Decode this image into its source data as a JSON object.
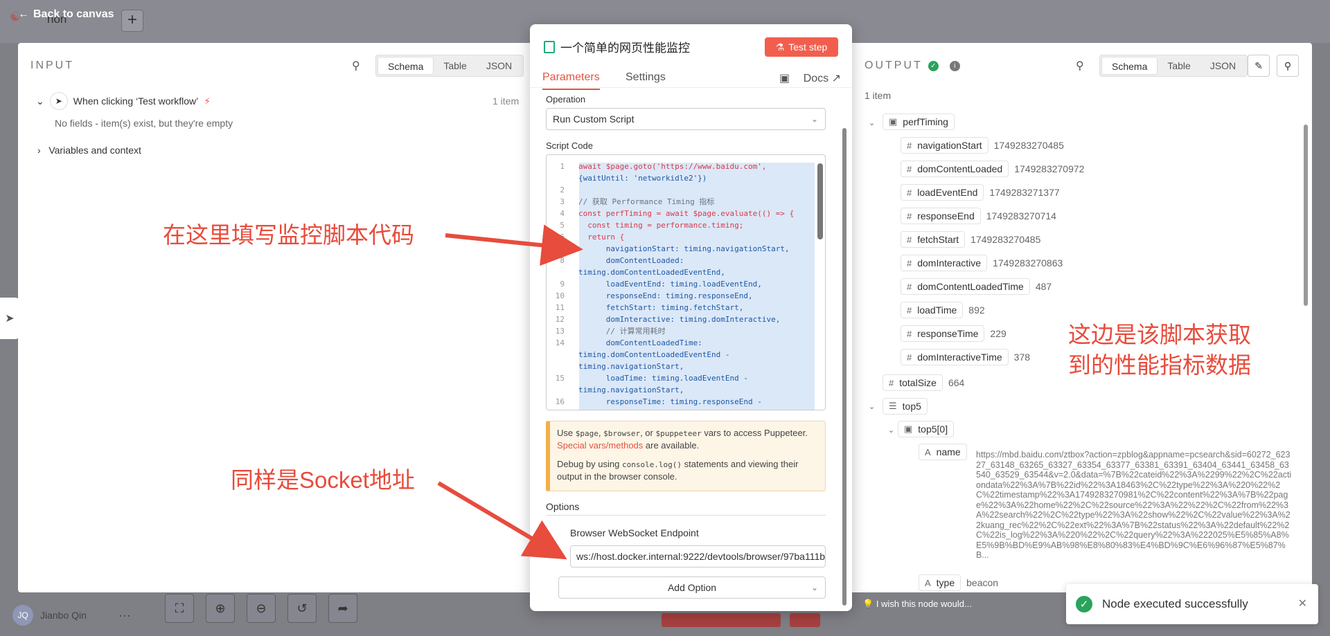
{
  "background": {
    "back_label": "Back to canvas",
    "workflow_name": "non",
    "plus": "+",
    "user_initials": "JQ",
    "user_name": "Jianbo Qin",
    "user_menu": "···"
  },
  "input": {
    "title": "INPUT",
    "views": [
      "Schema",
      "Table",
      "JSON"
    ],
    "trigger_label": "When clicking ‘Test workflow’",
    "trigger_count": "1 item",
    "no_fields": "No fields - item(s) exist, but they're empty",
    "vars_label": "Variables and context"
  },
  "annotations": {
    "script_note": "在这里填写监控脚本代码",
    "socket_note": "同样是Socket地址",
    "output_note_1": "这边是该脚本获取",
    "output_note_2": "到的性能指标数据",
    "annotation_color": "#e74c3c"
  },
  "node": {
    "title": "一个简单的网页性能监控",
    "test_step": "Test step",
    "tabs": [
      "Parameters",
      "Settings"
    ],
    "docs": "Docs",
    "operation_label": "Operation",
    "operation_value": "Run Custom Script",
    "script_label": "Script Code",
    "notice_1a": "Use ",
    "notice_code_1": "$page",
    "notice_sep_1": ", ",
    "notice_code_2": "$browser",
    "notice_sep_2": ", or ",
    "notice_code_3": "$puppeteer",
    "notice_1b": " vars to access Puppeteer. ",
    "notice_link": "Special vars/methods",
    "notice_1c": " are available.",
    "notice_2a": "Debug by using ",
    "notice_code_4": "console.log()",
    "notice_2b": " statements and viewing their output in the browser console.",
    "options_label": "Options",
    "ws_label": "Browser WebSocket Endpoint",
    "ws_value": "ws://host.docker.internal:9222/devtools/browser/97ba111b",
    "add_option": "Add Option",
    "accent": "#e5533c"
  },
  "code_lines": [
    {
      "n": "1",
      "t": "await $page.goto('https://www.baidu.com',"
    },
    {
      "n": "",
      "t": "{waitUntil: 'networkidle2'})"
    },
    {
      "n": "2",
      "t": ""
    },
    {
      "n": "3",
      "t": "// 获取 Performance Timing 指标"
    },
    {
      "n": "4",
      "t": "const perfTiming = await $page.evaluate(() => {"
    },
    {
      "n": "5",
      "t": "  const timing = performance.timing;"
    },
    {
      "n": "6",
      "t": "  return {"
    },
    {
      "n": "7",
      "t": "      navigationStart: timing.navigationStart,"
    },
    {
      "n": "8",
      "t": "      domContentLoaded:"
    },
    {
      "n": "",
      "t": "timing.domContentLoadedEventEnd,"
    },
    {
      "n": "9",
      "t": "      loadEventEnd: timing.loadEventEnd,"
    },
    {
      "n": "10",
      "t": "      responseEnd: timing.responseEnd,"
    },
    {
      "n": "11",
      "t": "      fetchStart: timing.fetchStart,"
    },
    {
      "n": "12",
      "t": "      domInteractive: timing.domInteractive,"
    },
    {
      "n": "13",
      "t": "      // 计算常用耗时"
    },
    {
      "n": "14",
      "t": "      domContentLoadedTime:"
    },
    {
      "n": "",
      "t": "timing.domContentLoadedEventEnd -"
    },
    {
      "n": "",
      "t": "timing.navigationStart,"
    },
    {
      "n": "15",
      "t": "      loadTime: timing.loadEventEnd -"
    },
    {
      "n": "",
      "t": "timing.navigationStart,"
    },
    {
      "n": "16",
      "t": "      responseTime: timing.responseEnd -"
    }
  ],
  "output": {
    "title": "OUTPUT",
    "views": [
      "Schema",
      "Table",
      "JSON"
    ],
    "count": "1 item",
    "perf_label": "perfTiming",
    "fields": [
      {
        "k": "navigationStart",
        "v": "1749283270485"
      },
      {
        "k": "domContentLoaded",
        "v": "1749283270972"
      },
      {
        "k": "loadEventEnd",
        "v": "1749283271377"
      },
      {
        "k": "responseEnd",
        "v": "1749283270714"
      },
      {
        "k": "fetchStart",
        "v": "1749283270485"
      },
      {
        "k": "domInteractive",
        "v": "1749283270863"
      },
      {
        "k": "domContentLoadedTime",
        "v": "487"
      },
      {
        "k": "loadTime",
        "v": "892"
      },
      {
        "k": "responseTime",
        "v": "229"
      },
      {
        "k": "domInteractiveTime",
        "v": "378"
      }
    ],
    "total_label": "totalSize",
    "total_value": "664",
    "top5_label": "top5",
    "top5_0_label": "top5[0]",
    "name_label": "name",
    "name_value": "https://mbd.baidu.com/ztbox?action=zpblog&appname=pcsearch&sid=60272_62327_63148_63265_63327_63354_63377_63381_63391_63404_63441_63458_63540_63529_63544&v=2.0&data=%7B%22cateid%22%3A%2299%22%2C%22actiondata%22%3A%7B%22id%22%3A18463%2C%22type%22%3A%220%22%2C%22timestamp%22%3A1749283270981%2C%22content%22%3A%7B%22page%22%3A%22home%22%2C%22source%22%3A%22%22%2C%22from%22%3A%22search%22%2C%22type%22%3A%22show%22%2C%22value%22%3A%22kuang_rec%22%2C%22ext%22%3A%7B%22status%22%3A%22default%22%2C%22is_log%22%3A%220%22%2C%22query%22%3A%222025%E5%85%A8%E5%9B%BD%E9%AB%98%E8%80%83%E4%BD%9C%E6%96%87%E5%87%B...",
    "type_label": "type",
    "type_value": "beacon",
    "wish": "I wish this node would...",
    "toast": "Node executed successfully"
  }
}
